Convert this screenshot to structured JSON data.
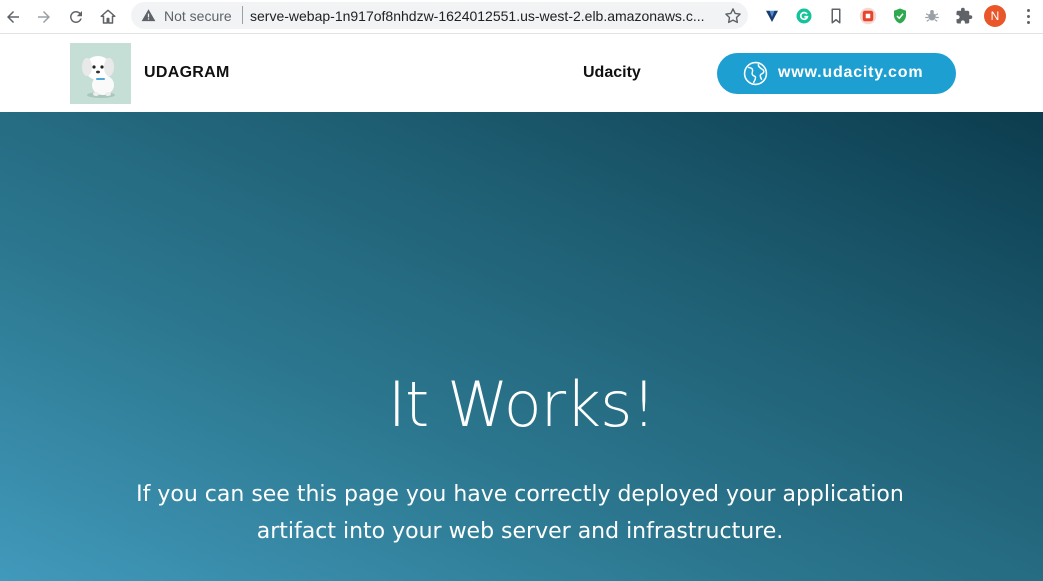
{
  "browser": {
    "security_label": "Not secure",
    "url": "serve-webap-1n917of8nhdzw-1624012551.us-west-2.elb.amazonaws.c...",
    "profile_initial": "N",
    "icons": [
      "back-icon",
      "forward-icon",
      "reload-icon",
      "home-icon",
      "warning-icon",
      "star-icon",
      "ext-v-icon",
      "grammarly-icon",
      "bookmark-icon",
      "ext-red-icon",
      "shield-icon",
      "ext-bug-icon",
      "puzzle-icon",
      "menu-icon"
    ]
  },
  "header": {
    "brand": "UDAGRAM",
    "nav_link": "Udacity",
    "cta_label": "www.udacity.com",
    "cta_color": "#1e9fd2"
  },
  "hero": {
    "title": "It Works!",
    "line1": "If you can see this page you have correctly deployed your application",
    "line2": "artifact into your web server and infrastructure."
  }
}
